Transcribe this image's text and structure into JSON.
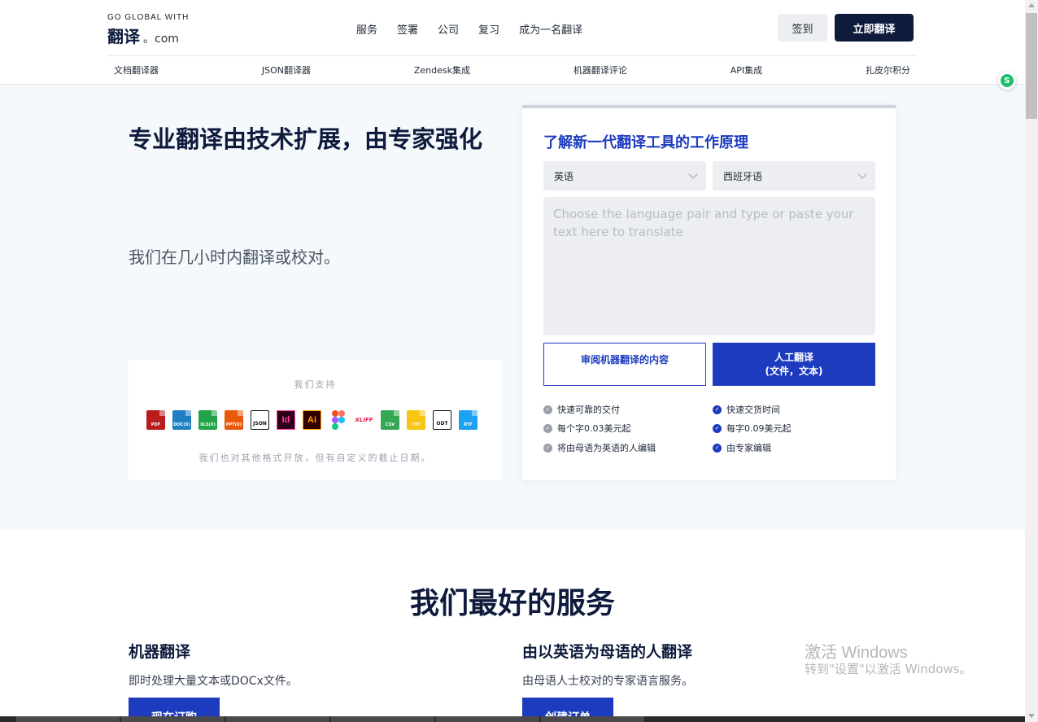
{
  "header": {
    "logo_tagline": "GO GLOBAL WITH",
    "logo_name": "翻译",
    "logo_domain": "。com",
    "nav": [
      "服务",
      "签署",
      "公司",
      "复习",
      "成为一名翻译"
    ],
    "login_label": "签到",
    "translate_now_label": "立即翻译"
  },
  "subnav": [
    "文档翻译器",
    "JSON翻译器",
    "Zendesk集成",
    "机器翻译评论",
    "API集成",
    "扎皮尔积分"
  ],
  "hero": {
    "title": "专业翻译由技术扩展，由专家强化",
    "subtitle": "我们在几小时内翻译或校对。"
  },
  "support": {
    "title": "我们支持",
    "formats": [
      {
        "label": "PDF",
        "color": "#b91c1c"
      },
      {
        "label": "DOC(X)",
        "color": "#1f7fc2"
      },
      {
        "label": "XLS(X)",
        "color": "#22a34a"
      },
      {
        "label": "PPT(X)",
        "color": "#ea580c"
      },
      {
        "label": "JSON",
        "color": "#ffffff"
      },
      {
        "label": "Id",
        "color": "#d6006f"
      },
      {
        "label": "Ai",
        "color": "#ff7a00"
      },
      {
        "label": "figma",
        "color": "#a259ff"
      },
      {
        "label": "XLIFF",
        "color": "#e11d48"
      },
      {
        "label": "CSV",
        "color": "#34a853"
      },
      {
        "label": "TXT",
        "color": "#f9c513"
      },
      {
        "label": "ODT",
        "color": "#ffffff"
      },
      {
        "label": "RTF",
        "color": "#1da1f2"
      }
    ],
    "note": "我们也对其他格式开放，但有自定义的截止日期。"
  },
  "card": {
    "title": "了解新一代翻译工具的工作原理",
    "source_lang": "英语",
    "target_lang": "西班牙语",
    "placeholder": "Choose the language pair and type or paste your text here to translate",
    "review_button": "审阅机器翻译的内容",
    "human_button_line1": "人工翻译",
    "human_button_line2": "(文件，文本)",
    "features_left": [
      "快速可靠的交付",
      "每个字0.03美元起",
      "将由母语为英语的人编辑"
    ],
    "features_right": [
      "快速交货时间",
      "每字0.09美元起",
      "由专家编辑"
    ]
  },
  "services": {
    "title": "我们最好的服务",
    "items": [
      {
        "heading": "机器翻译",
        "desc": "即时处理大量文本或DOCx文件。",
        "button": "现在订购"
      },
      {
        "heading": "由以英语为母语的人翻译",
        "desc": "由母语人士校对的专家语言服务。",
        "button": "创建订单"
      }
    ]
  },
  "watermark": {
    "line1": "激活 Windows",
    "line2": "转到\"设置\"以激活 Windows。"
  },
  "colors": {
    "brand_navy": "#0f1b3d",
    "accent_blue": "#1d3bbf",
    "hero_bg": "#f5f9fc"
  }
}
